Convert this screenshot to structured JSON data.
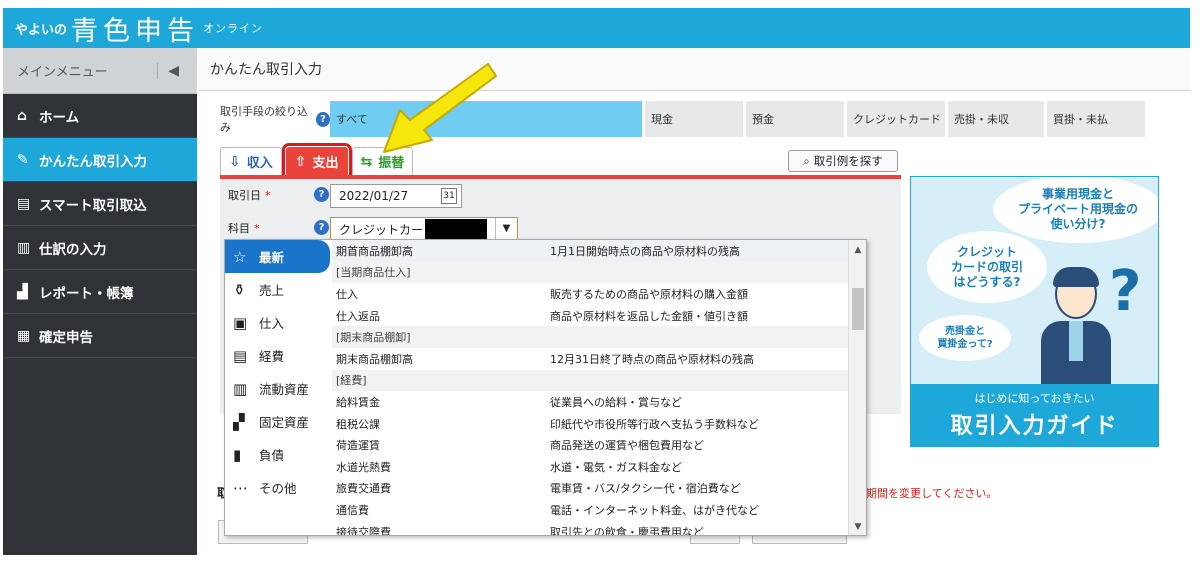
{
  "header": {
    "brand_small": "やよいの",
    "brand_big": "青色申告",
    "brand_sub": "オンライン",
    "bg_color": "#1ea8da"
  },
  "sidebar": {
    "title": "メインメニュー",
    "collapse_icon": "◀",
    "items": [
      {
        "icon": "home-icon",
        "label": "ホーム",
        "active": false
      },
      {
        "icon": "pencil-icon",
        "label": "かんたん取引入力",
        "active": true
      },
      {
        "icon": "smart-import-icon",
        "label": "スマート取引取込",
        "active": false
      },
      {
        "icon": "journal-icon",
        "label": "仕訳の入力",
        "active": false
      },
      {
        "icon": "report-icon",
        "label": "レポート・帳簿",
        "active": false
      },
      {
        "icon": "tax-return-icon",
        "label": "確定申告",
        "active": false
      }
    ]
  },
  "page": {
    "title": "かんたん取引入力"
  },
  "filter": {
    "label": "取引手段の絞り込み",
    "options": [
      "すべて",
      "現金",
      "預金",
      "クレジットカード",
      "売掛・未収",
      "買掛・未払"
    ],
    "selected": "すべて"
  },
  "tabs": {
    "income": "収入",
    "expense": "支出",
    "transfer": "振替",
    "active": "支出"
  },
  "search_example_label": "取引例を探す",
  "form": {
    "date_label": "取引日",
    "date_value": "2022/01/27",
    "account_label": "科目",
    "account_value": "クレジットカー",
    "required_mark": "*"
  },
  "account_dropdown": {
    "categories": [
      {
        "icon": "star-icon",
        "label": "最新",
        "active": true
      },
      {
        "icon": "money-bag-icon",
        "label": "売上",
        "active": false
      },
      {
        "icon": "box-icon",
        "label": "仕入",
        "active": false
      },
      {
        "icon": "receipt-icon",
        "label": "経費",
        "active": false
      },
      {
        "icon": "assets-icon",
        "label": "流動資産",
        "active": false
      },
      {
        "icon": "truck-icon",
        "label": "固定資産",
        "active": false
      },
      {
        "icon": "liability-icon",
        "label": "負債",
        "active": false
      },
      {
        "icon": "more-icon",
        "label": "その他",
        "active": false
      }
    ],
    "items": [
      {
        "type": "item",
        "name": "期首商品棚卸高",
        "desc": "1月1日開始時点の商品や原材料の残高"
      },
      {
        "type": "group",
        "name": "[当期商品仕入]",
        "desc": ""
      },
      {
        "type": "item",
        "name": "仕入",
        "desc": "販売するための商品や原材料の購入金額"
      },
      {
        "type": "item",
        "name": "仕入返品",
        "desc": "商品や原材料を返品した金額・値引き額"
      },
      {
        "type": "group",
        "name": "[期末商品棚卸]",
        "desc": ""
      },
      {
        "type": "item",
        "name": "期末商品棚卸高",
        "desc": "12月31日終了時点の商品や原材料の残高"
      },
      {
        "type": "group",
        "name": "[経費]",
        "desc": ""
      },
      {
        "type": "item",
        "name": "給料賃金",
        "desc": "従業員への給料・賞与など"
      },
      {
        "type": "item",
        "name": "租税公課",
        "desc": "印紙代や市役所等行政へ支払う手数料など"
      },
      {
        "type": "item",
        "name": "荷造運賃",
        "desc": "商品発送の運賃や梱包費用など"
      },
      {
        "type": "item",
        "name": "水道光熱費",
        "desc": "水道・電気・ガス料金など"
      },
      {
        "type": "item",
        "name": "旅費交通費",
        "desc": "電車賃・バス/タクシー代・宿泊費など"
      },
      {
        "type": "item",
        "name": "通信費",
        "desc": "電話・インターネット料金、はがき代など"
      },
      {
        "type": "item",
        "name": "接待交際費",
        "desc": "取引先との飲食・慶弔費用など"
      }
    ]
  },
  "ad": {
    "bubble1": "事業用現金と\nプライベート用現金の\n使い分け?",
    "bubble2": "クレジット\nカードの取引\nはどうする?",
    "bubble3": "売掛金と\n買掛金って?",
    "question_mark": "?",
    "bottom_small": "はじめに知っておきたい",
    "bottom_big": "取引入力ガイド"
  },
  "lower": {
    "label": "取",
    "note": "期間を変更してください。"
  },
  "colors": {
    "accent_blue": "#1ea8da",
    "expense_red": "#e8443a",
    "highlight_yellow": "#f5e60c"
  }
}
